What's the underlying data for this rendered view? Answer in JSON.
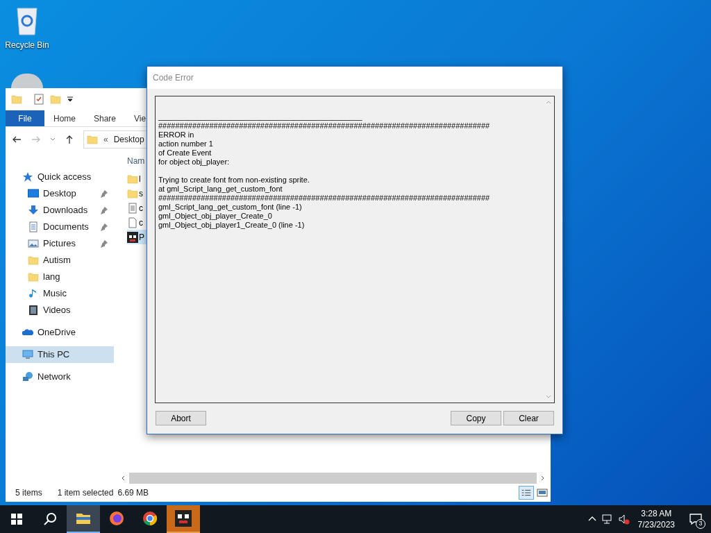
{
  "desktop": {
    "icons": [
      {
        "label": "Recycle Bin"
      }
    ]
  },
  "explorer": {
    "ribbon_tabs": [
      {
        "label": "File",
        "selected": true
      },
      {
        "label": "Home",
        "selected": false
      },
      {
        "label": "Share",
        "selected": false
      },
      {
        "label": "Vie",
        "selected": false
      }
    ],
    "address": {
      "prefix": "«",
      "path": "Desktop"
    },
    "column_header": "Nam",
    "nav": [
      {
        "label": "Quick access",
        "kind": "star",
        "selected": false,
        "children": [
          {
            "label": "Desktop",
            "kind": "desktop",
            "pinned": true,
            "selected": false
          },
          {
            "label": "Downloads",
            "kind": "download",
            "pinned": true,
            "selected": false
          },
          {
            "label": "Documents",
            "kind": "document",
            "pinned": true,
            "selected": false
          },
          {
            "label": "Pictures",
            "kind": "picture",
            "pinned": true,
            "selected": false
          },
          {
            "label": "Autism",
            "kind": "folder",
            "pinned": false,
            "selected": false
          },
          {
            "label": "lang",
            "kind": "folder",
            "pinned": false,
            "selected": false
          },
          {
            "label": "Music",
            "kind": "music",
            "pinned": false,
            "selected": false
          },
          {
            "label": "Videos",
            "kind": "video",
            "pinned": false,
            "selected": false
          }
        ]
      },
      {
        "label": "OneDrive",
        "kind": "cloud",
        "selected": false
      },
      {
        "label": "This PC",
        "kind": "pc",
        "selected": true
      },
      {
        "label": "Network",
        "kind": "network",
        "selected": false
      }
    ],
    "files": [
      {
        "name": "l",
        "kind": "folder",
        "selected": false
      },
      {
        "name": "s",
        "kind": "folder",
        "selected": false
      },
      {
        "name": "c",
        "kind": "text",
        "selected": false
      },
      {
        "name": "c",
        "kind": "blank",
        "selected": false
      },
      {
        "name": "P",
        "kind": "game",
        "selected": true
      }
    ],
    "status_bar": {
      "count": "5 items",
      "selection": "1 item selected",
      "size": "6.69 MB"
    }
  },
  "dialog": {
    "title": "Code Error",
    "blocks": [
      [
        "________________________________________________",
        "##############################################################################",
        "ERROR in",
        "action number 1",
        "of Create Event",
        "for object obj_player:"
      ],
      [
        "Trying to create font from non-existing sprite.",
        "at gml_Script_lang_get_custom_font",
        "##############################################################################",
        "gml_Script_lang_get_custom_font (line -1)",
        "gml_Object_obj_player_Create_0",
        "gml_Object_obj_player1_Create_0 (line -1)"
      ]
    ],
    "left_buttons": [
      "Abort"
    ],
    "right_buttons": [
      "Copy",
      "Clear"
    ]
  },
  "taskbar": {
    "apps": [
      {
        "kind": "explorer",
        "active": true,
        "running": false
      },
      {
        "kind": "firefox",
        "active": false,
        "running": false
      },
      {
        "kind": "chrome",
        "active": false,
        "running": false
      },
      {
        "kind": "game",
        "active": false,
        "running": true
      }
    ],
    "time": "3:28 AM",
    "date": "7/23/2023",
    "notifications": "3"
  }
}
